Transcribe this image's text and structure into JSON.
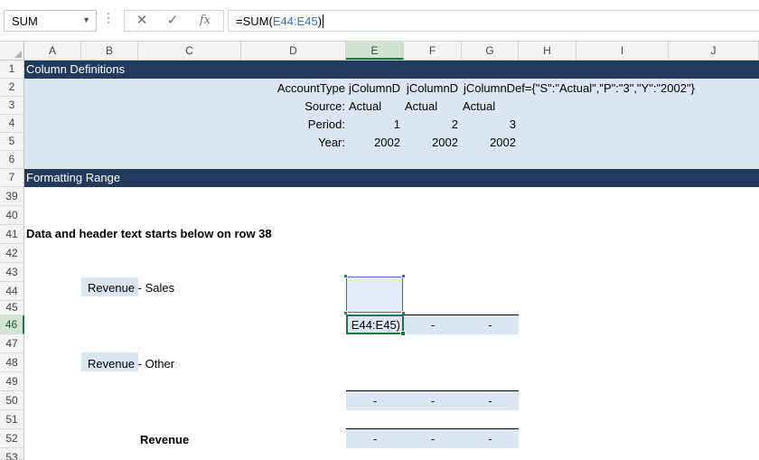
{
  "formula_bar": {
    "name_box": "SUM",
    "cancel_icon": "✕",
    "enter_icon": "✓",
    "function_icon": "fx",
    "formula_prefix": "=SUM(",
    "formula_ref": "E44:E45",
    "formula_suffix": ")"
  },
  "columns": [
    "A",
    "B",
    "C",
    "D",
    "E",
    "F",
    "G",
    "H",
    "I",
    "J"
  ],
  "selected_column": "E",
  "rows": [
    "1",
    "2",
    "3",
    "4",
    "5",
    "6",
    "7",
    "39",
    "40",
    "41",
    "42",
    "43",
    "44",
    "45",
    "46",
    "47",
    "48",
    "49",
    "50",
    "51",
    "52",
    "53"
  ],
  "selected_row": "46",
  "sections": {
    "column_definitions": "Column Definitions",
    "formatting_range": "Formatting Range"
  },
  "definitions": {
    "row2": {
      "label": "AccountType",
      "e": "jColumnD",
      "f": "jColumnD",
      "g": "jColumnDef={\"S\":\"Actual\",\"P\":\"3\",\"Y\":\"2002\"}"
    },
    "row3": {
      "label": "Source:",
      "e": "Actual",
      "f": "Actual",
      "g": "Actual"
    },
    "row4": {
      "label": "Period:",
      "e": "1",
      "f": "2",
      "g": "3"
    },
    "row5": {
      "label": "Year:",
      "e": "2002",
      "f": "2002",
      "g": "2002"
    }
  },
  "note": "Data and header text starts below on row 38",
  "revenue_sales": {
    "label": "Revenue",
    "suffix": " - Sales"
  },
  "revenue_other": {
    "label": "Revenue",
    "suffix": " - Other"
  },
  "revenue_total": "Revenue",
  "edit_cell_text": "E44:E45)",
  "dash": "-",
  "colors": {
    "section_band": "#213a5e",
    "light_band": "#dce6f0",
    "selection_green": "#217346",
    "reference_blue": "#3b6fc4"
  }
}
